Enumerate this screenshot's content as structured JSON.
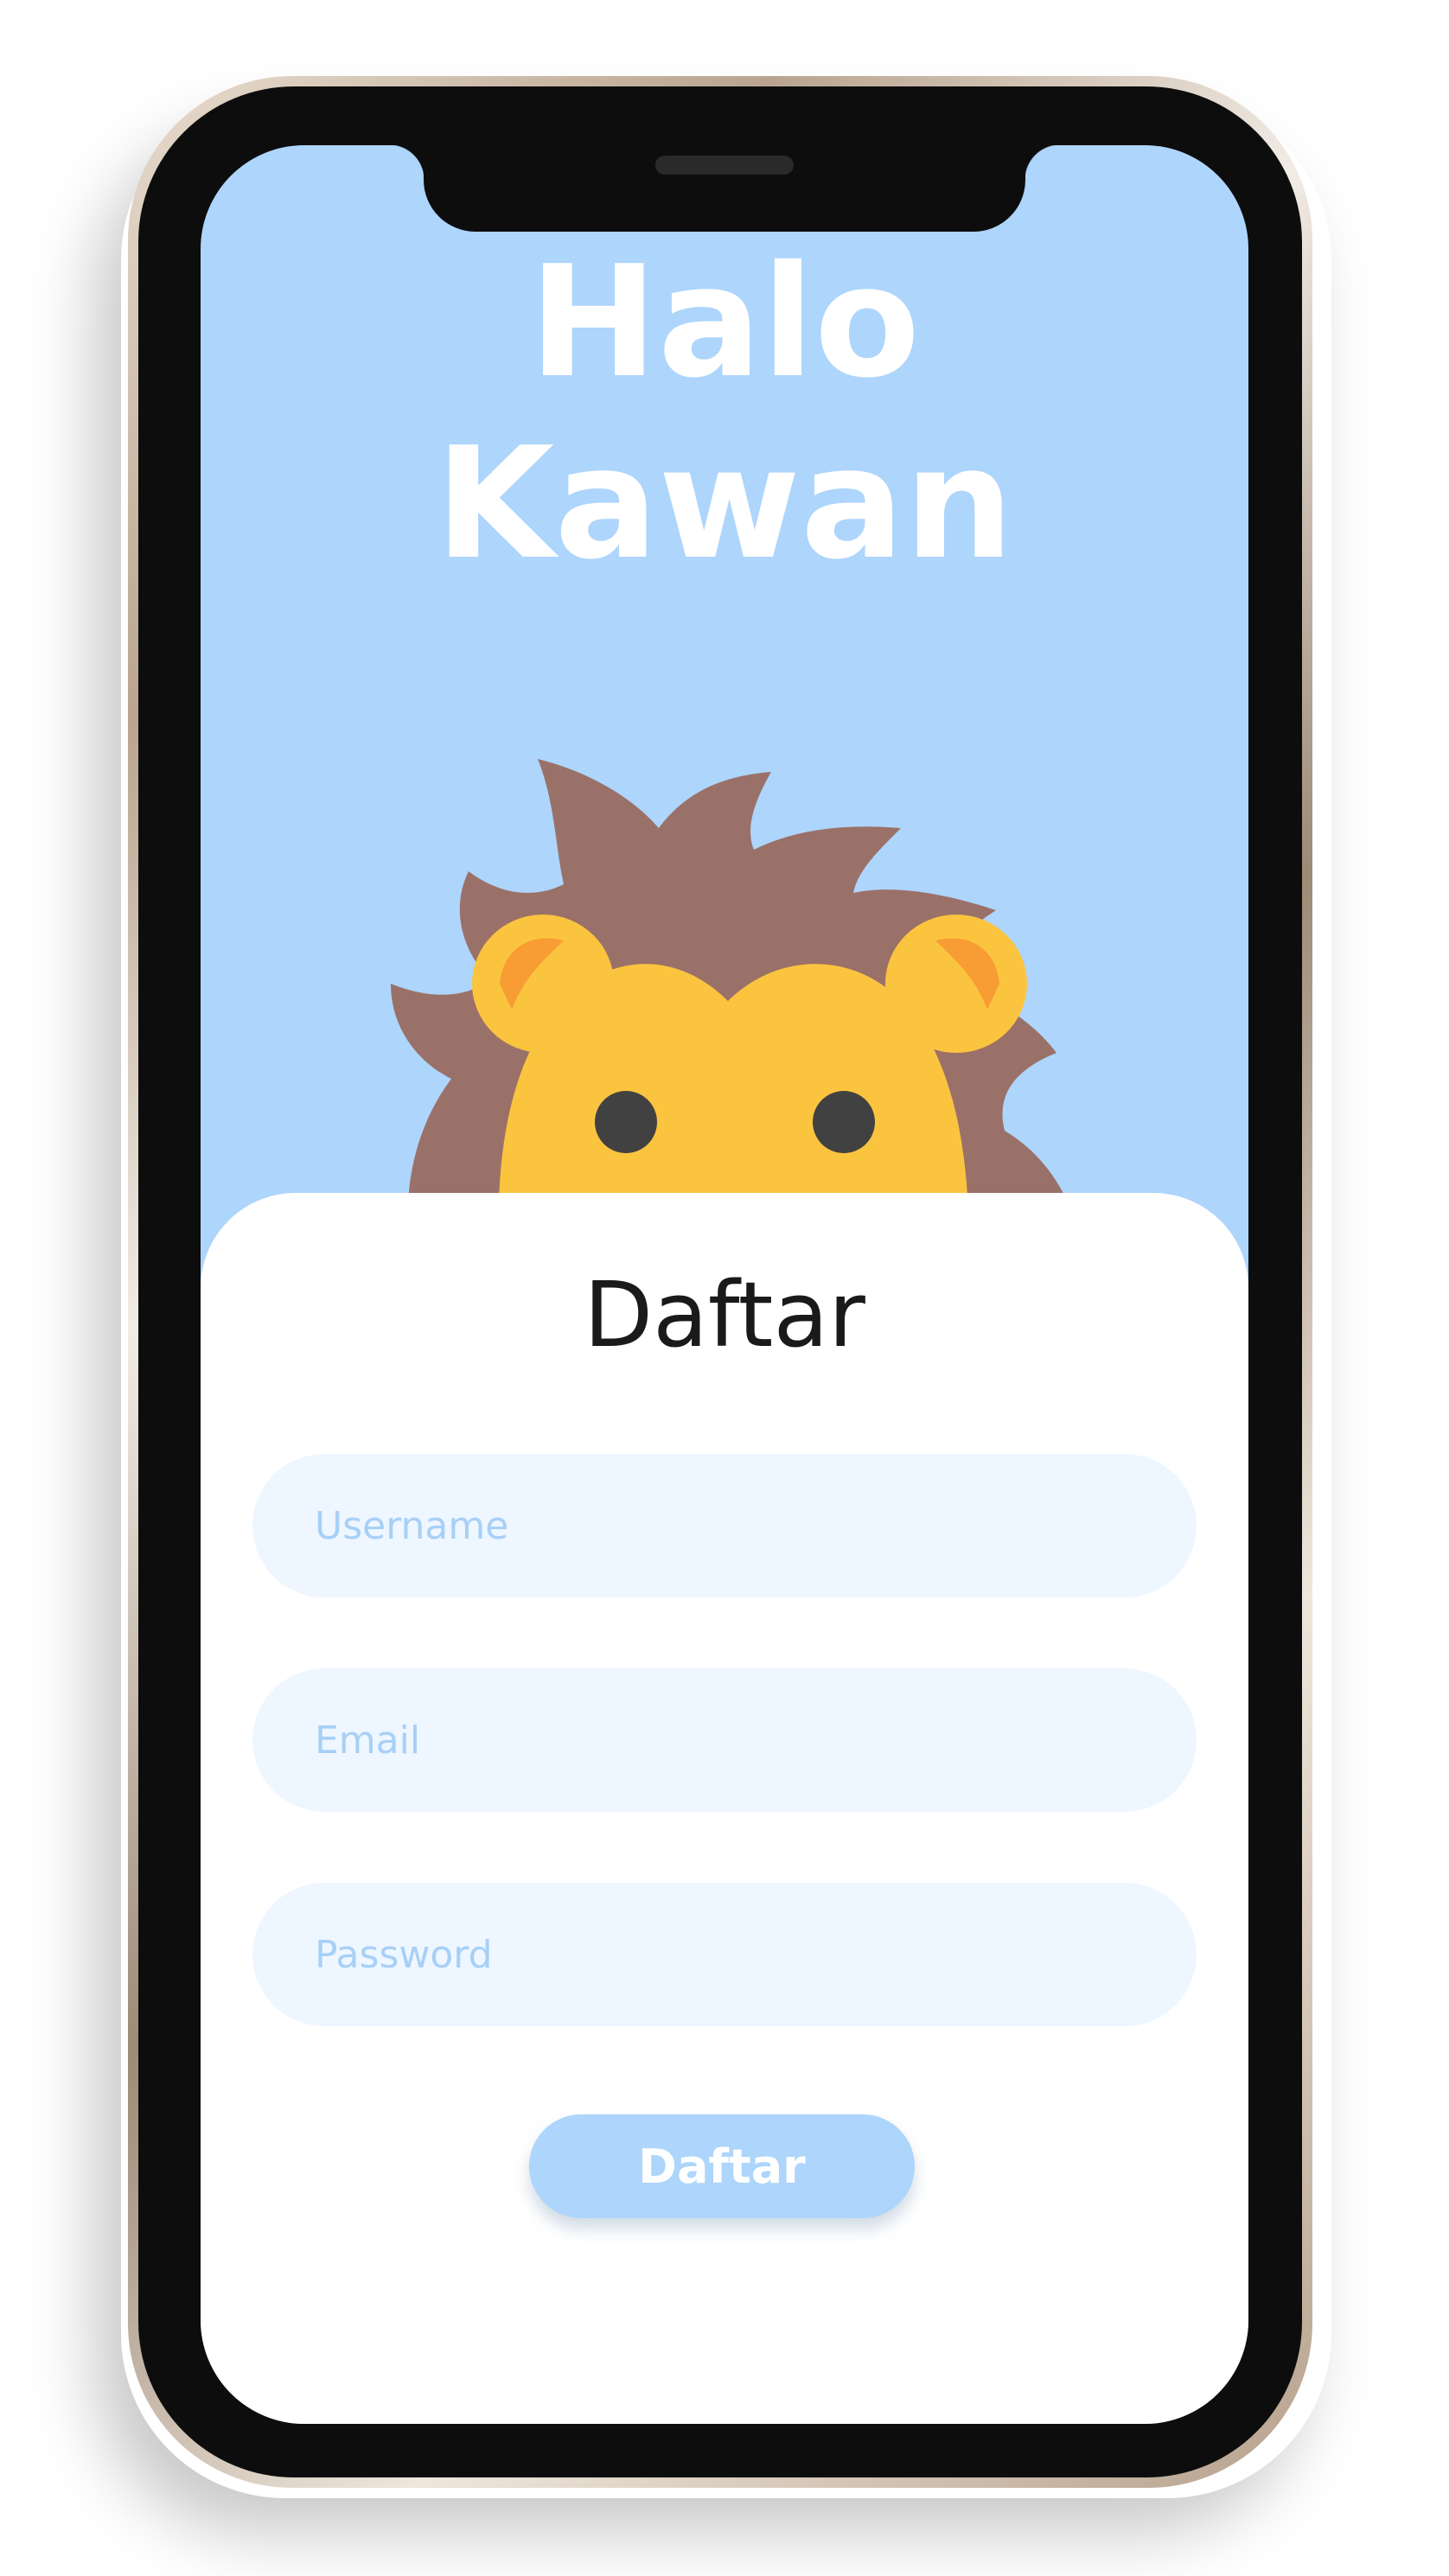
{
  "hero": {
    "greeting_line1": "Halo",
    "greeting_line2": "Kawan",
    "mascot_icon": "lion-mascot-icon"
  },
  "form": {
    "title": "Daftar",
    "username_placeholder": "Username",
    "email_placeholder": "Email",
    "password_placeholder": "Password",
    "submit_label": "Daftar"
  },
  "colors": {
    "sky": "#aed5fb",
    "field_bg": "#eef6ff",
    "placeholder": "#a7d0f7",
    "lion_mane": "#9a7168",
    "lion_face": "#fbc43f",
    "lion_ear_inner": "#f89c34",
    "lion_muzzle": "#fcd591",
    "eyes_nose": "#414141"
  }
}
